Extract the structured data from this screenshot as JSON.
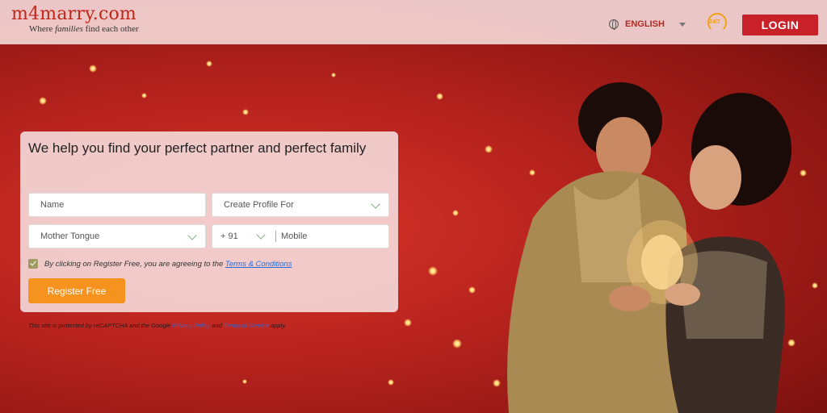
{
  "header": {
    "logo": "m4marry.com",
    "tagline_pre": "Where ",
    "tagline_em": "families",
    "tagline_post": " find each other",
    "language": "ENGLISH",
    "support_badge": "24/7",
    "login_label": "LOGIN"
  },
  "form": {
    "title": "We help you find your perfect partner and perfect family",
    "name_placeholder": "Name",
    "profile_for_placeholder": "Create Profile For",
    "mother_tongue_placeholder": "Mother Tongue",
    "country_code": "+ 91",
    "mobile_placeholder": "Mobile",
    "consent_text": "By clicking on Register Free, you are agreeing to the ",
    "terms_link": "Terms & Conditions",
    "register_label": "Register Free"
  },
  "recaptcha": {
    "pre": "This site is protected by reCAPTCHA and the Google ",
    "privacy_link": "Privacy Policy",
    "mid": " and ",
    "terms_link": "Terms of Service",
    "post": " apply."
  },
  "colors": {
    "brand_red": "#c8212a",
    "accent_orange": "#f6921e",
    "background_red": "#b8231e"
  }
}
